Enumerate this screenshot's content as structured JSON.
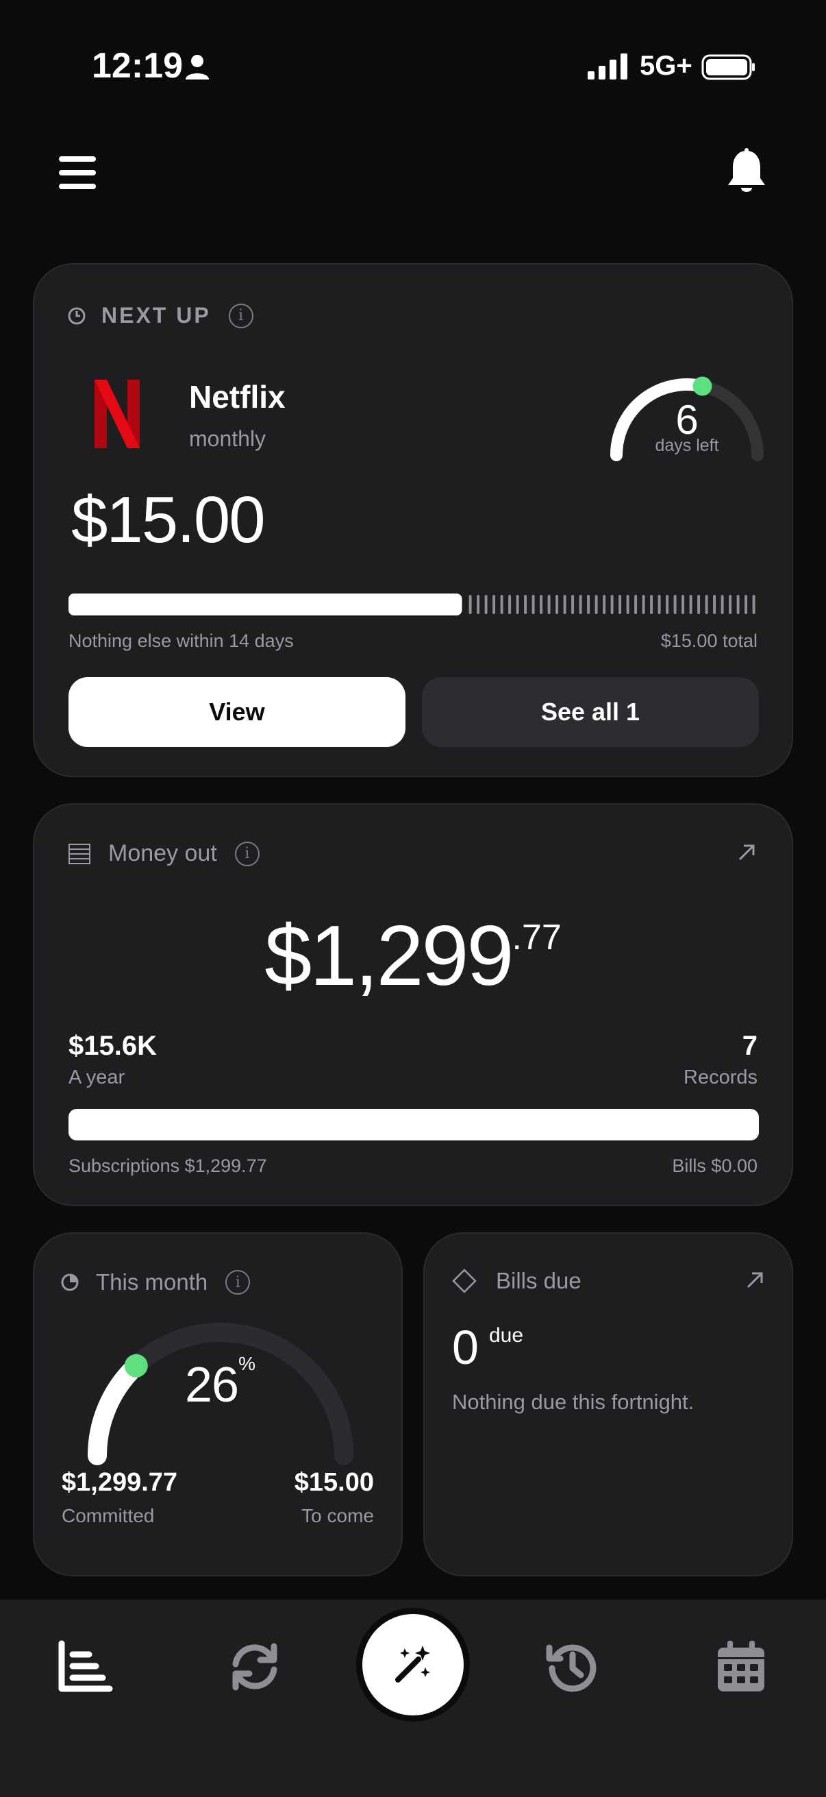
{
  "status_bar": {
    "time": "12:19",
    "network": "5G+"
  },
  "next_up": {
    "title": "NEXT UP",
    "service": "Netflix",
    "frequency": "monthly",
    "days_left_value": "6",
    "days_left_label": "days left",
    "amount": "$15.00",
    "note_left": "Nothing else within 14 days",
    "note_right": "$15.00 total",
    "view_label": "View",
    "see_all_label": "See all 1",
    "progress_fraction": 0.57,
    "days_gauge_fraction": 0.57
  },
  "money_out": {
    "title": "Money out",
    "amount_whole": "$1,299",
    "amount_cents": ".77",
    "year_value": "$15.6K",
    "year_label": "A year",
    "records_value": "7",
    "records_label": "Records",
    "subscriptions": "Subscriptions $1,299.77",
    "bills": "Bills $0.00"
  },
  "this_month": {
    "title": "This month",
    "percent": "26",
    "percent_sign": "%",
    "percent_fraction": 0.26,
    "committed_value": "$1,299.77",
    "committed_label": "Committed",
    "to_come_value": "$15.00",
    "to_come_label": "To come"
  },
  "bills_due": {
    "title": "Bills due",
    "count": "0",
    "due_label": "due",
    "note": "Nothing due this fortnight."
  },
  "colors": {
    "background": "#0b0b0c",
    "card": "#1e1e21",
    "accent_green": "#5fe080",
    "netflix_red": "#e50914",
    "muted_text": "#9a9aa0"
  },
  "bottom_nav": {
    "items": [
      "chart-icon",
      "refresh-icon",
      "magic-wand-icon",
      "history-icon",
      "calendar-icon"
    ]
  }
}
